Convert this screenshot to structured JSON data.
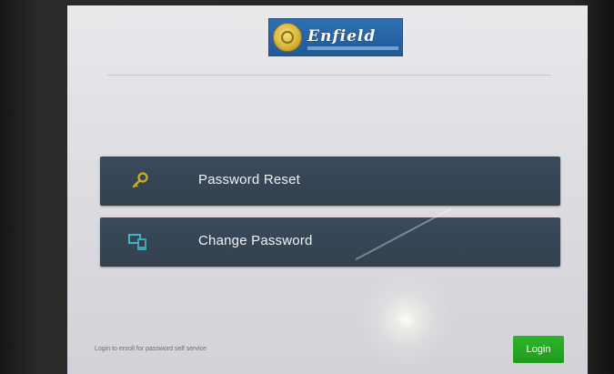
{
  "logo": {
    "name": "Enfield",
    "seal_color": "#d8b63c",
    "brand_color": "#1f5a98"
  },
  "menu": {
    "items": [
      {
        "label": "Password Reset",
        "icon": "key-icon",
        "icon_color": "#c9b11a"
      },
      {
        "label": "Change Password",
        "icon": "device-icon",
        "icon_color": "#3fb6c4"
      }
    ],
    "button_color": "#33414f"
  },
  "footer": {
    "note": "Login to enroll for password self service",
    "login_label": "Login",
    "login_color": "#1f9a1e"
  }
}
